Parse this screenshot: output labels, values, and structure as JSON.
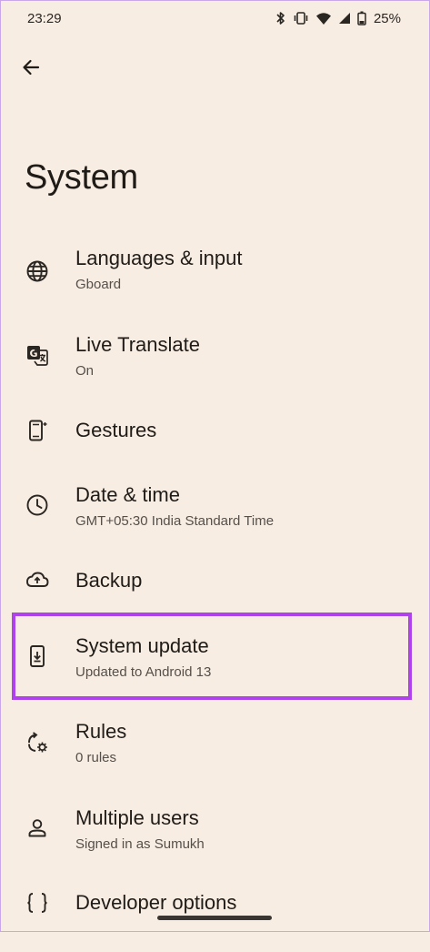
{
  "status_bar": {
    "time": "23:29",
    "battery": "25%",
    "icons": [
      "bluetooth-icon",
      "vibrate-icon",
      "wifi-icon",
      "cell-signal-icon",
      "battery-icon"
    ]
  },
  "header": {
    "back_icon": "back-arrow-icon",
    "title": "System"
  },
  "items": [
    {
      "title": "Languages & input",
      "subtitle": "Gboard",
      "icon": "globe-icon"
    },
    {
      "title": "Live Translate",
      "subtitle": "On",
      "icon": "translate-icon"
    },
    {
      "title": "Gestures",
      "subtitle": "",
      "icon": "gestures-phone-icon"
    },
    {
      "title": "Date & time",
      "subtitle": "GMT+05:30 India Standard Time",
      "icon": "clock-icon"
    },
    {
      "title": "Backup",
      "subtitle": "",
      "icon": "cloud-upload-icon"
    },
    {
      "title": "System update",
      "subtitle": "Updated to Android 13",
      "icon": "system-update-icon"
    },
    {
      "title": "Rules",
      "subtitle": "0 rules",
      "icon": "rules-icon"
    },
    {
      "title": "Multiple users",
      "subtitle": "Signed in as Sumukh",
      "icon": "person-icon"
    },
    {
      "title": "Developer options",
      "subtitle": "",
      "icon": "braces-icon"
    }
  ],
  "highlight_color": "#b042ec",
  "background_color": "#f8ede3"
}
